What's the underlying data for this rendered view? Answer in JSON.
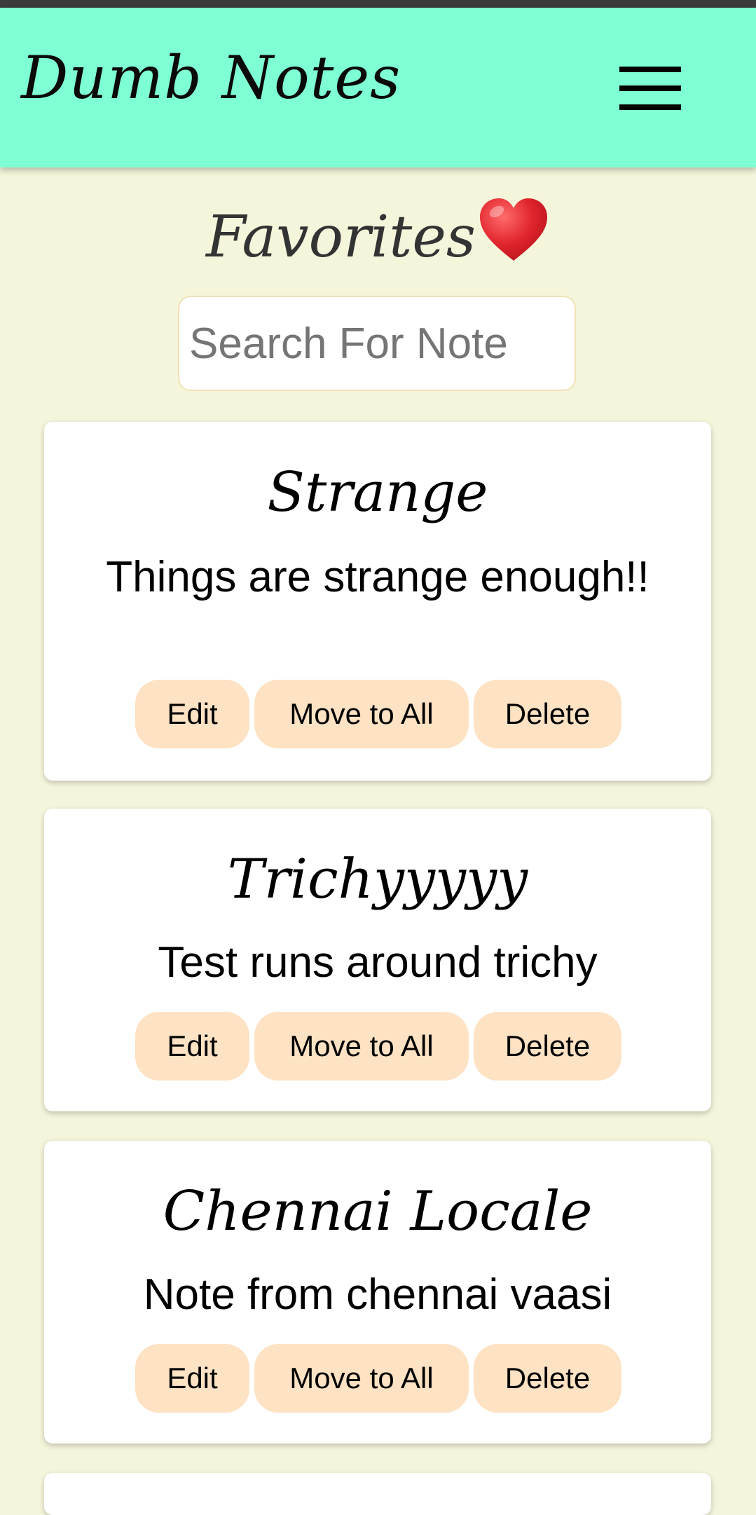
{
  "app": {
    "brand": "Dumb Notes"
  },
  "page": {
    "title": "Favorites"
  },
  "search": {
    "placeholder": "Search For Note",
    "value": ""
  },
  "buttons": {
    "edit": "Edit",
    "move": "Move to All",
    "delete": "Delete"
  },
  "notes": [
    {
      "title": "Strange",
      "body": "Things are strange enough!!"
    },
    {
      "title": "Trichyyyyy",
      "body": "Test runs around trichy"
    },
    {
      "title": "Chennai Locale",
      "body": "Note from chennai vaasi"
    }
  ],
  "colors": {
    "navbar": "#7fffd4",
    "background": "#f5f5dc",
    "card": "#ffffff",
    "button": "#fde2c3",
    "heart": "#e0242c"
  }
}
